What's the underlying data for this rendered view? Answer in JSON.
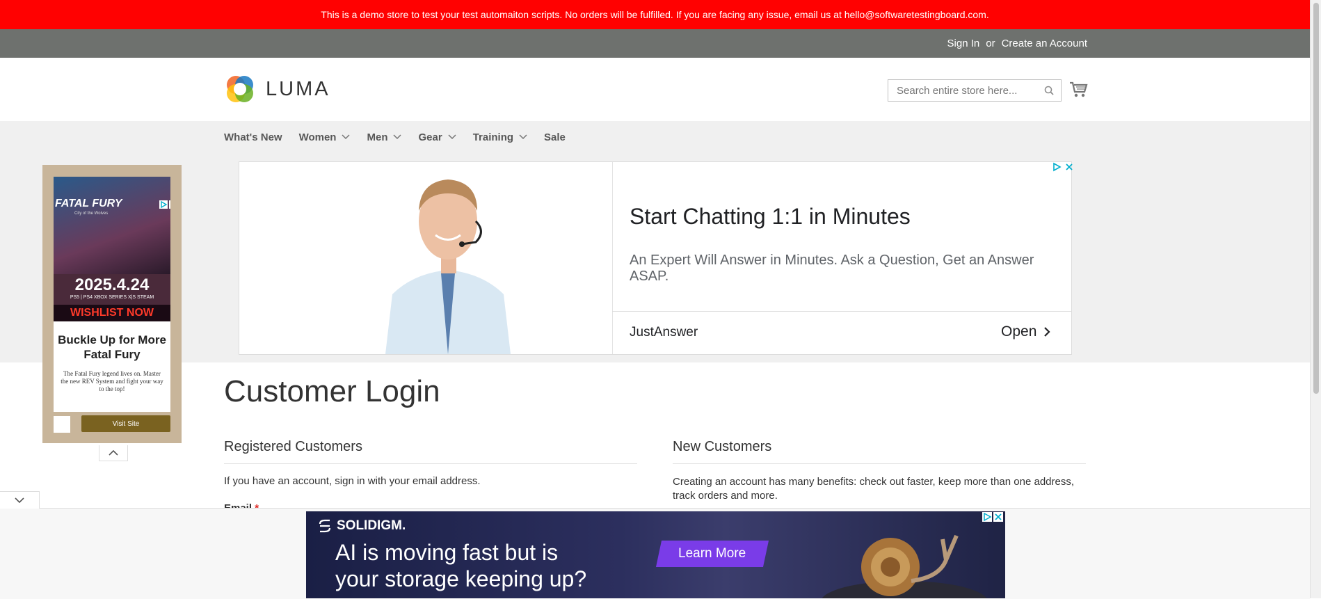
{
  "demo_banner": {
    "text": "This is a demo store to test your test automaiton scripts. No orders will be fulfilled. If you are facing any issue, email us at hello@softwaretestingboard.com."
  },
  "header": {
    "sign_in": "Sign In",
    "or": "or",
    "create_account": "Create an Account",
    "logo_text": "LUMA",
    "search_placeholder": "Search entire store here..."
  },
  "nav": {
    "items": [
      {
        "label": "What's New",
        "has_dropdown": false
      },
      {
        "label": "Women",
        "has_dropdown": true
      },
      {
        "label": "Men",
        "has_dropdown": true
      },
      {
        "label": "Gear",
        "has_dropdown": true
      },
      {
        "label": "Training",
        "has_dropdown": true
      },
      {
        "label": "Sale",
        "has_dropdown": false
      }
    ]
  },
  "ad_main": {
    "headline": "Start Chatting 1:1 in Minutes",
    "description": "An Expert Will Answer in Minutes. Ask a Question, Get an Answer ASAP.",
    "brand": "JustAnswer",
    "cta": "Open"
  },
  "ad_side": {
    "game_title": "FATAL FURY",
    "game_subtitle": "City of the Wolves",
    "date": "2025.4.24",
    "platforms": "PS5 | PS4   XBOX SERIES X|S   STEAM",
    "wishlist": "WISHLIST NOW",
    "title": "Buckle Up for More Fatal Fury",
    "body": "The Fatal Fury legend lives on. Master the new REV System and fight your way to the top!",
    "cta": "Visit Site"
  },
  "main": {
    "page_title": "Customer Login",
    "registered": {
      "title": "Registered Customers",
      "text": "If you have an account, sign in with your email address.",
      "email_label": "Email",
      "required_mark": "*"
    },
    "new_customers": {
      "title": "New Customers",
      "text": "Creating an account has many benefits: check out faster, keep more than one address, track orders and more."
    }
  },
  "ad_bottom": {
    "brand": "SOLIDIGM.",
    "text_line1": "AI is moving fast but is",
    "text_line2": "your storage keeping up?",
    "cta": "Learn More"
  },
  "colors": {
    "demo_banner": "#ff0101",
    "header_panel": "#6e716e",
    "nav_bg": "#f0f0f0",
    "cta_purple": "#7a3ce8"
  }
}
